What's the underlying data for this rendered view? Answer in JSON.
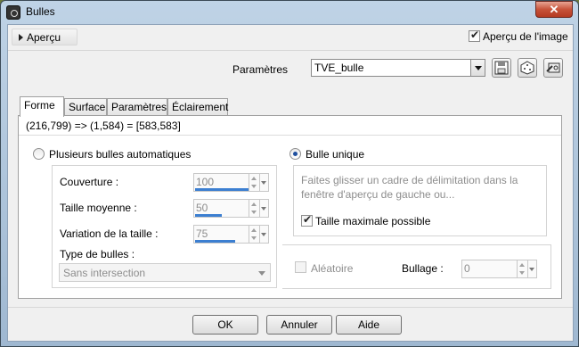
{
  "window": {
    "title": "Bulles"
  },
  "top": {
    "apercu_label": "Aperçu",
    "apercu_image_label": "Aperçu de l'image",
    "apercu_image_checked": true,
    "parametres_label": "Paramètres",
    "preset_value": "TVE_bulle",
    "icons": [
      "save-icon",
      "random-dice-icon",
      "reset-icon"
    ]
  },
  "tabs": [
    {
      "label": "Forme",
      "active": true
    },
    {
      "label": "Surface",
      "active": false
    },
    {
      "label": "Paramètres",
      "active": false
    },
    {
      "label": "Éclairement",
      "active": false
    }
  ],
  "coords_text": "(216,799) => (1,584) = [583,583]",
  "left_group": {
    "radio_label": "Plusieurs bulles automatiques",
    "selected": false,
    "fields": [
      {
        "label": "Couverture :",
        "value": "100",
        "fill": 1.0
      },
      {
        "label": "Taille moyenne :",
        "value": "50",
        "fill": 0.5
      },
      {
        "label": "Variation de la taille :",
        "value": "75",
        "fill": 0.75
      }
    ],
    "type_label": "Type de bulles :",
    "type_value": "Sans intersection"
  },
  "right_group": {
    "radio_label": "Bulle unique",
    "selected": true,
    "hint": "Faites glisser un cadre de délimitation dans la fenêtre d'aperçu de gauche ou...",
    "max_size_label": "Taille maximale possible",
    "max_size_checked": true
  },
  "random_label": "Aléatoire",
  "bullage_label": "Bullage :",
  "bullage_value": "0",
  "buttons": {
    "ok": "OK",
    "cancel": "Annuler",
    "help": "Aide"
  }
}
